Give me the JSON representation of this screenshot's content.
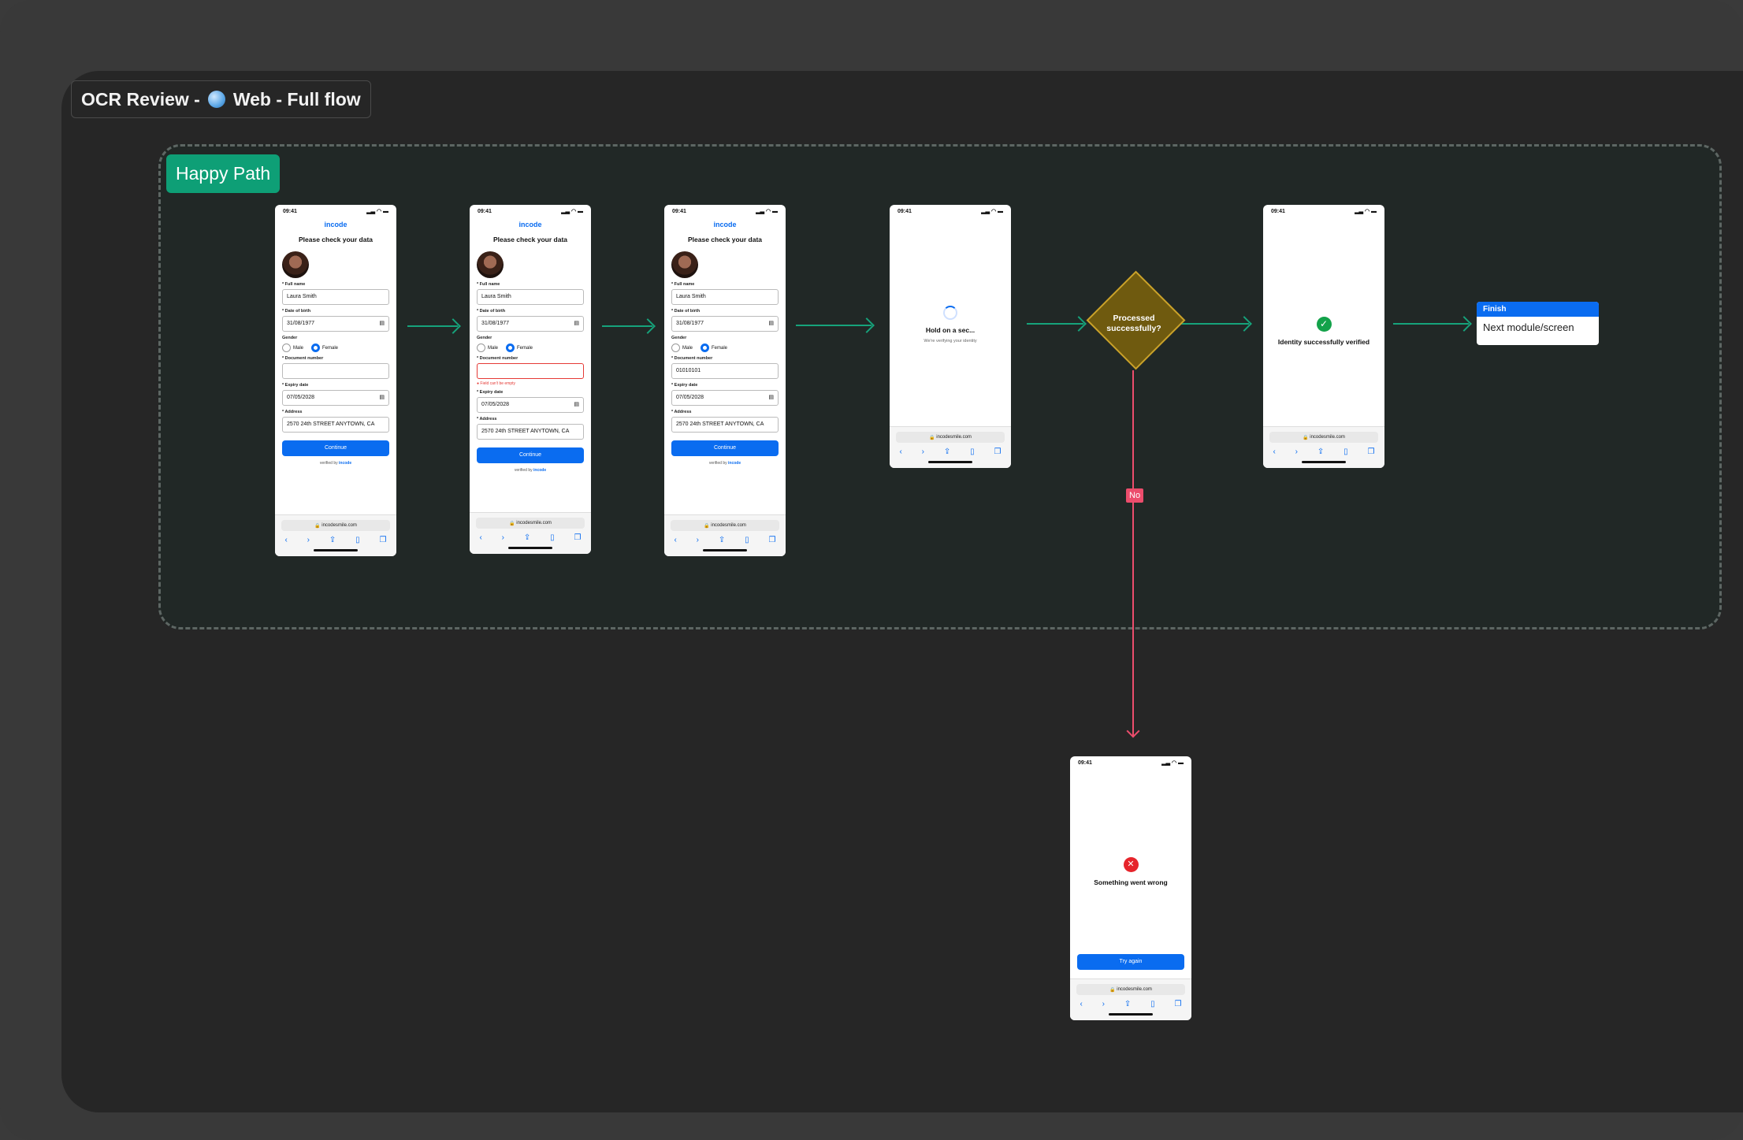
{
  "frame": {
    "title_prefix": "OCR Review -",
    "title_suffix": "Web - Full flow"
  },
  "section": {
    "label": "Happy Path"
  },
  "phone": {
    "time": "09:41",
    "logo": "incode",
    "title": "Please check your data",
    "full_name_label": "* Full name",
    "full_name": "Laura Smith",
    "dob_label": "* Date of birth",
    "dob": "31/08/1977",
    "gender_label": "Gender",
    "male": "Male",
    "female": "Female",
    "docnum_label": "* Document number",
    "docnum_value": "01010101",
    "doc_error": "Field can't be empty",
    "expiry_label": "* Expiry date",
    "expiry": "07/05/2028",
    "address_label": "* Address",
    "address": "2570 24th STREET ANYTOWN, CA",
    "continue": "Continue",
    "verified_prefix": "verified by",
    "verified_brand": "incode",
    "url": "incodesmile.com",
    "hold_title": "Hold on a sec...",
    "hold_sub": "We're verifying your identity",
    "success": "Identity successfully verified",
    "fail": "Something went wrong",
    "try_again": "Try again"
  },
  "decision": {
    "text": "Processed successfully?",
    "no_label": "No"
  },
  "finish": {
    "header": "Finish",
    "body": "Next module/screen"
  },
  "colors": {
    "accent": "#0a6cf0",
    "section": "#0e9f76",
    "arrow": "#16a37b",
    "no_path": "#ec4d6c",
    "decision": "#6f5a0f"
  }
}
